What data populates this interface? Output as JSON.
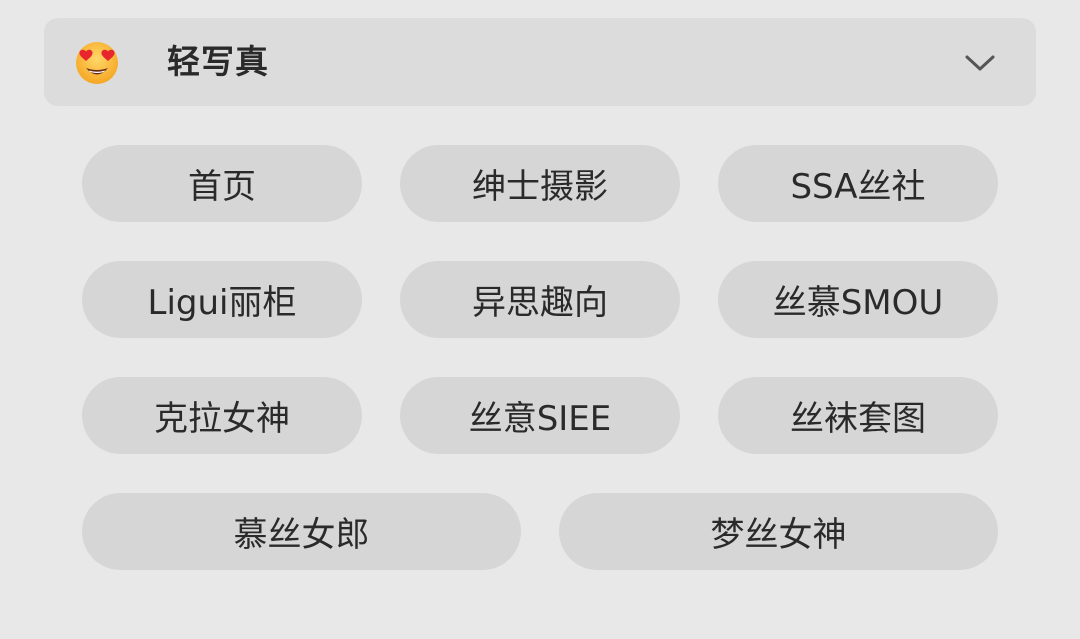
{
  "header": {
    "emoji": "heart-eyes-emoji",
    "title": "轻写真",
    "chevron": "chevron-down-icon"
  },
  "categories": [
    {
      "label": "首页"
    },
    {
      "label": "绅士摄影"
    },
    {
      "label": "SSA丝社"
    },
    {
      "label": "Ligui丽柜"
    },
    {
      "label": "异思趣向"
    },
    {
      "label": "丝慕SMOU"
    },
    {
      "label": "克拉女神"
    },
    {
      "label": "丝意SIEE"
    },
    {
      "label": "丝袜套图"
    },
    {
      "label": "慕丝女郎"
    },
    {
      "label": "梦丝女神"
    }
  ],
  "colors": {
    "background": "#e8e8e8",
    "header_bg": "#dcdcdc",
    "pill_bg": "#d6d6d6",
    "text": "#2a2a2a"
  }
}
